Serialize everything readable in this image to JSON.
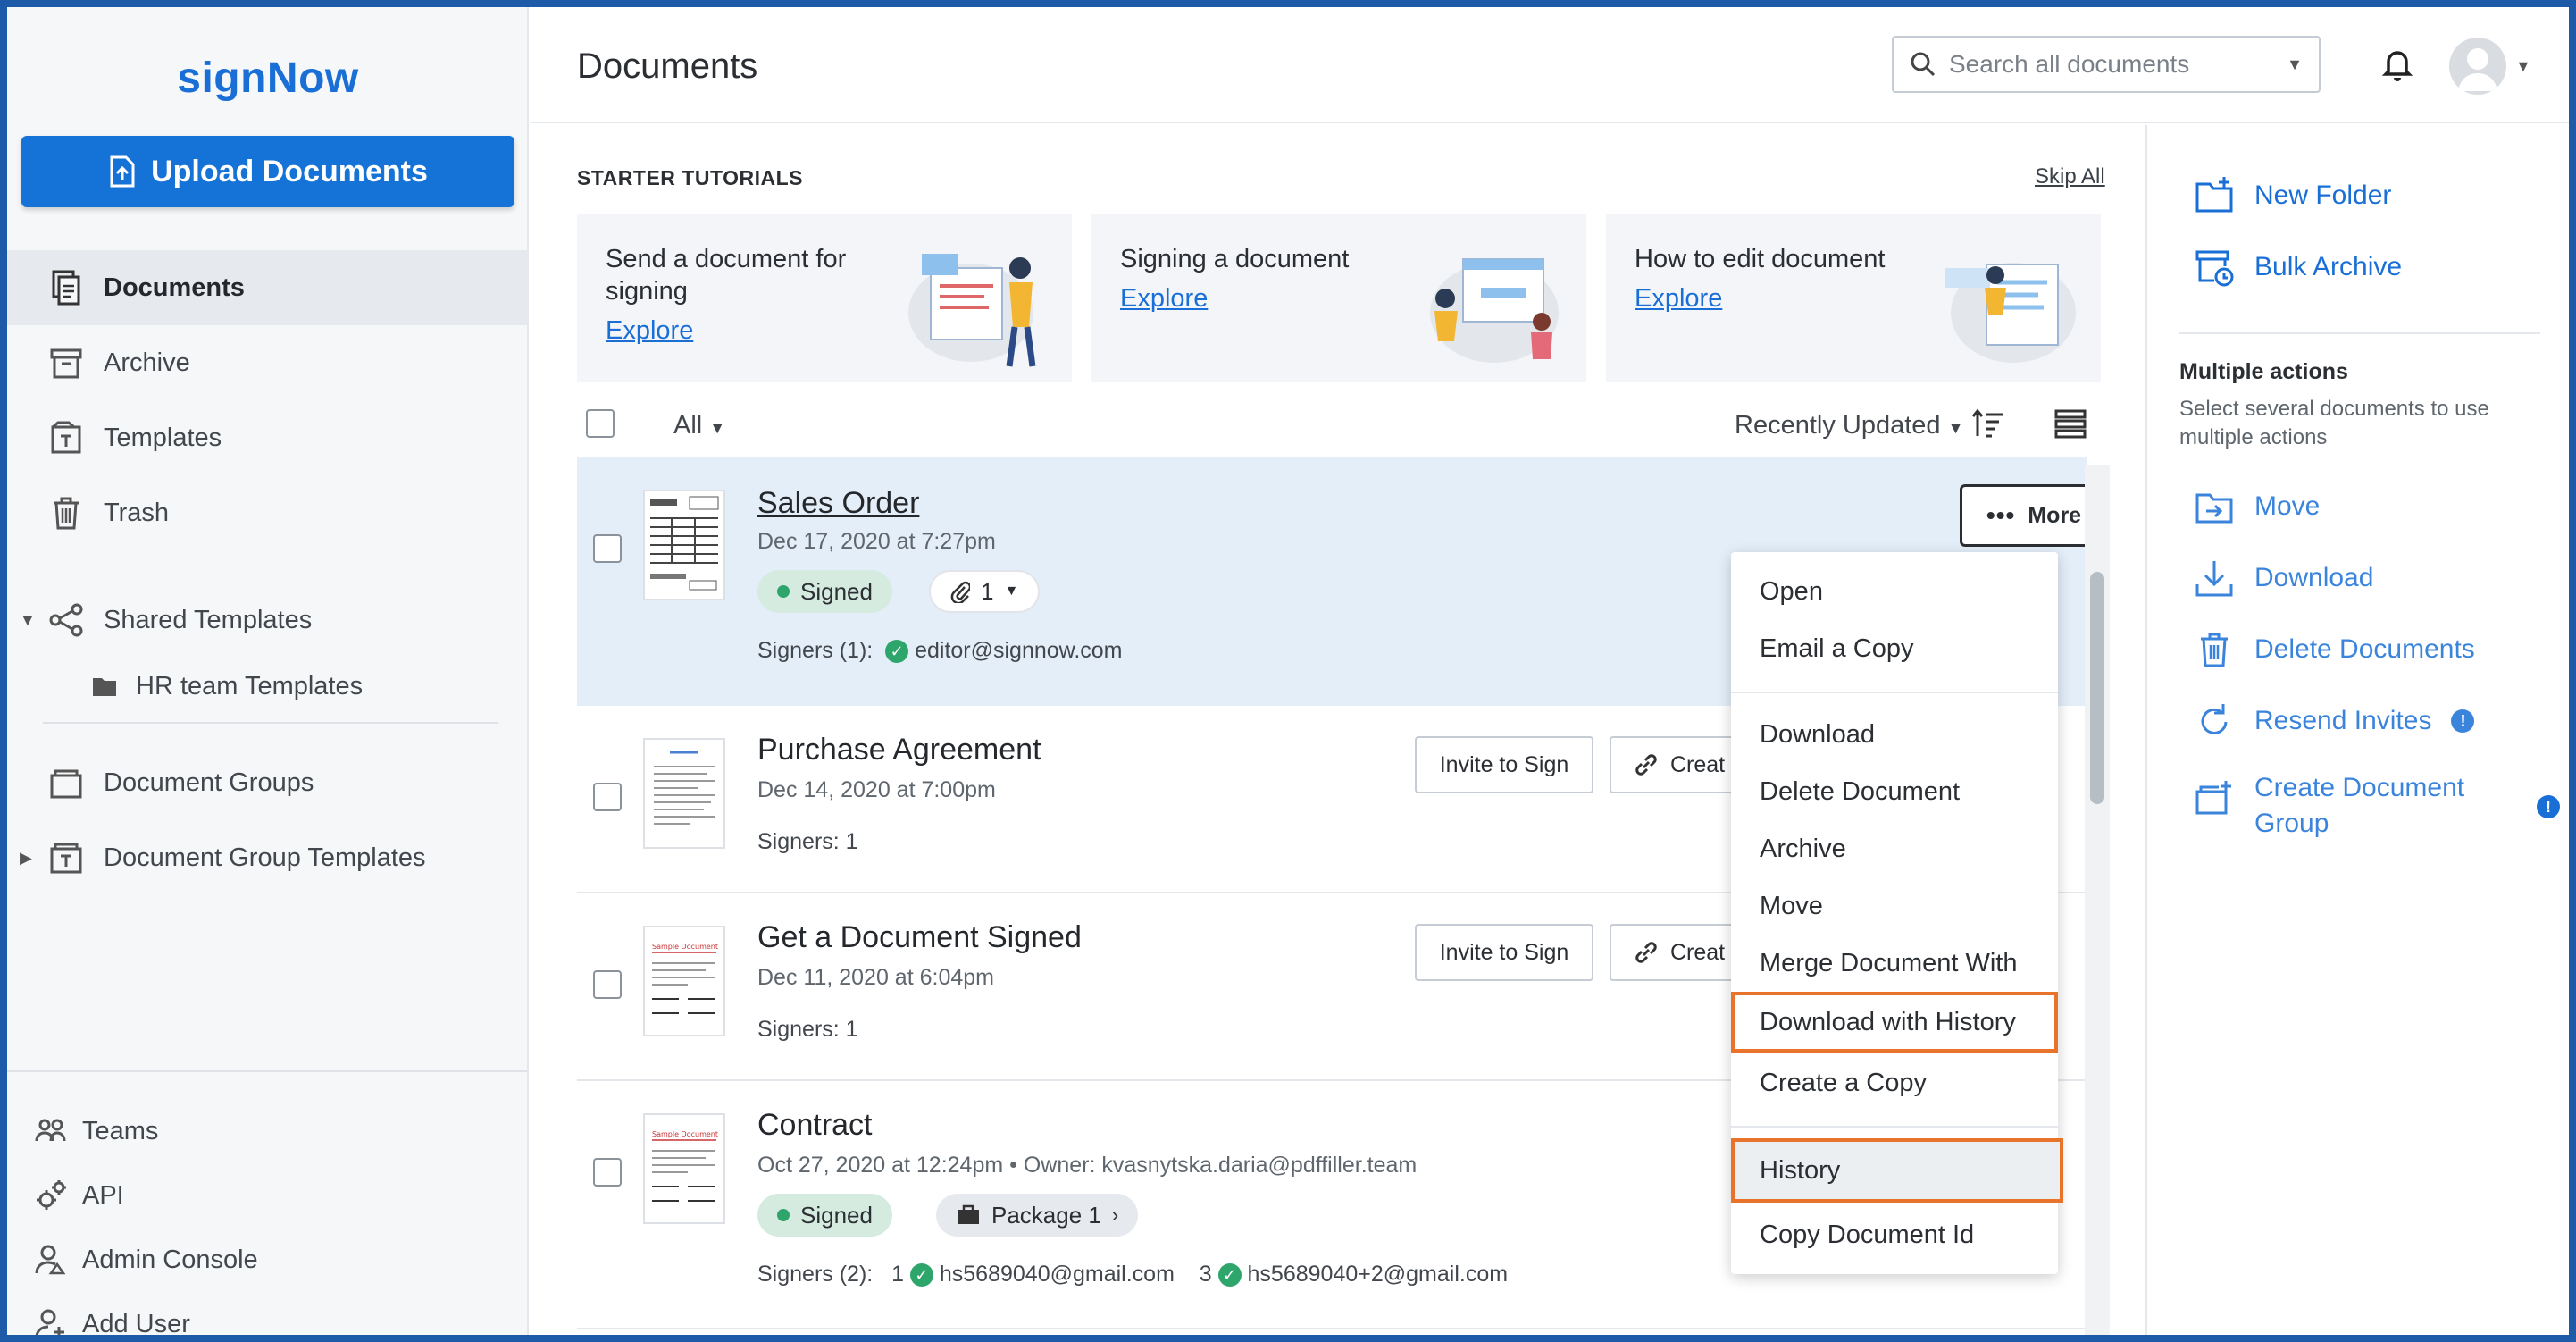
{
  "app": {
    "logo": "signNow",
    "page_title": "Documents"
  },
  "sidebar": {
    "upload_label": "Upload Documents",
    "items": [
      {
        "label": "Documents"
      },
      {
        "label": "Archive"
      },
      {
        "label": "Templates"
      },
      {
        "label": "Trash"
      },
      {
        "label": "Shared Templates"
      },
      {
        "label": "HR team Templates"
      },
      {
        "label": "Document Groups"
      },
      {
        "label": "Document Group Templates"
      }
    ],
    "bottom": [
      {
        "label": "Teams"
      },
      {
        "label": "API"
      },
      {
        "label": "Admin Console"
      },
      {
        "label": "Add User"
      }
    ]
  },
  "header": {
    "search_placeholder": "Search all documents"
  },
  "tutorials": {
    "title": "STARTER TUTORIALS",
    "skip_all": "Skip All",
    "cards": [
      {
        "title": "Send a document for signing",
        "link": "Explore"
      },
      {
        "title": "Signing a document",
        "link": "Explore"
      },
      {
        "title": "How to edit document",
        "link": "Explore"
      }
    ]
  },
  "toolbar": {
    "filter": "All",
    "sort": "Recently Updated"
  },
  "documents": [
    {
      "name": "Sales Order",
      "date": "Dec 17, 2020 at 7:27pm",
      "status": "Signed",
      "attachments": "1",
      "signers_label": "Signers (1):",
      "signer": "editor@signnow.com",
      "more": "More"
    },
    {
      "name": "Purchase Agreement",
      "date": "Dec 14, 2020 at 7:00pm",
      "signers": "Signers: 1",
      "invite": "Invite to Sign",
      "create": "Creat"
    },
    {
      "name": "Get a Document Signed",
      "date": "Dec 11, 2020 at 6:04pm",
      "signers": "Signers: 1",
      "invite": "Invite to Sign",
      "create": "Creat"
    },
    {
      "name": "Contract",
      "date": "Oct 27, 2020 at 12:24pm",
      "owner": "• Owner: kvasnytska.daria@pdffiller.team",
      "status": "Signed",
      "package": "Package 1",
      "signers_label": "Signers (2):",
      "signer1_num": "1",
      "signer1": "hs5689040@gmail.com",
      "signer2_num": "3",
      "signer2": "hs5689040+2@gmail.com"
    }
  ],
  "menu": {
    "items": [
      "Open",
      "Email a Copy",
      "Download",
      "Delete Document",
      "Archive",
      "Move",
      "Merge Document With",
      "Download with History",
      "Create a Copy",
      "History",
      "Copy Document Id"
    ]
  },
  "right_panel": {
    "new_folder": "New Folder",
    "bulk_archive": "Bulk Archive",
    "multi_title": "Multiple actions",
    "multi_desc": "Select several documents to use multiple actions",
    "actions": [
      "Move",
      "Download",
      "Delete Documents",
      "Resend Invites",
      "Create Document Group"
    ]
  },
  "colors": {
    "brand": "#1a6fd6",
    "upload_button": "#1572d6",
    "highlight": "#e8732a",
    "signed": "#2ea56b"
  }
}
